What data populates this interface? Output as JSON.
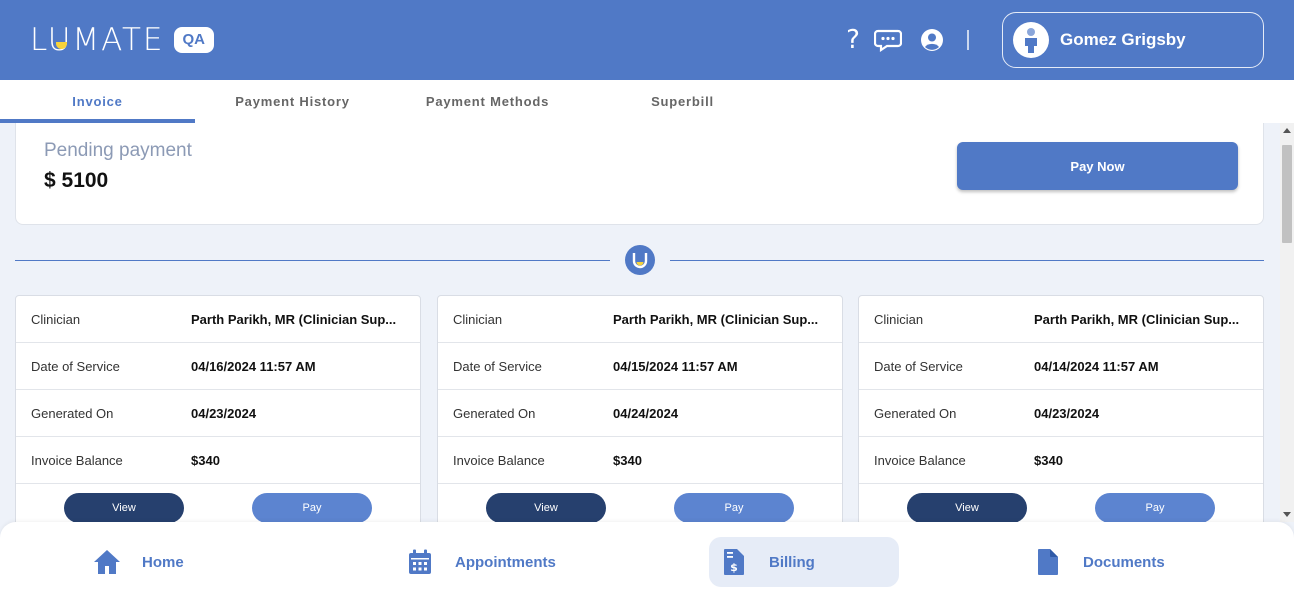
{
  "brand": {
    "name": "LUMATE",
    "badge": "QA"
  },
  "header": {
    "help_symbol": "?",
    "user_name": "Gomez Grigsby"
  },
  "tabs": [
    {
      "label": "Invoice",
      "active": true
    },
    {
      "label": "Payment History",
      "active": false
    },
    {
      "label": "Payment Methods",
      "active": false
    },
    {
      "label": "Superbill",
      "active": false
    }
  ],
  "pending": {
    "label": "Pending payment",
    "amount": "$ 5100",
    "pay_now_label": "Pay Now"
  },
  "invoice_labels": {
    "clinician": "Clinician",
    "date_of_service": "Date of Service",
    "generated_on": "Generated On",
    "invoice_balance": "Invoice Balance",
    "view": "View",
    "pay": "Pay"
  },
  "invoices": [
    {
      "clinician": "Parth Parikh, MR (Clinician Sup...",
      "date_of_service": "04/16/2024 11:57 AM",
      "generated_on": "04/23/2024",
      "invoice_balance": "$340"
    },
    {
      "clinician": "Parth Parikh, MR (Clinician Sup...",
      "date_of_service": "04/15/2024 11:57 AM",
      "generated_on": "04/24/2024",
      "invoice_balance": "$340"
    },
    {
      "clinician": "Parth Parikh, MR (Clinician Sup...",
      "date_of_service": "04/14/2024 11:57 AM",
      "generated_on": "04/23/2024",
      "invoice_balance": "$340"
    }
  ],
  "bottom_nav": [
    {
      "label": "Home",
      "icon": "home-icon",
      "active": false
    },
    {
      "label": "Appointments",
      "icon": "calendar-icon",
      "active": false
    },
    {
      "label": "Billing",
      "icon": "invoice-dollar-icon",
      "active": true
    },
    {
      "label": "Documents",
      "icon": "document-icon",
      "active": false
    }
  ],
  "colors": {
    "primary": "#5079c6",
    "dark_button": "#26406e",
    "accent_yellow": "#f6d23a",
    "background": "#eef2f9"
  }
}
